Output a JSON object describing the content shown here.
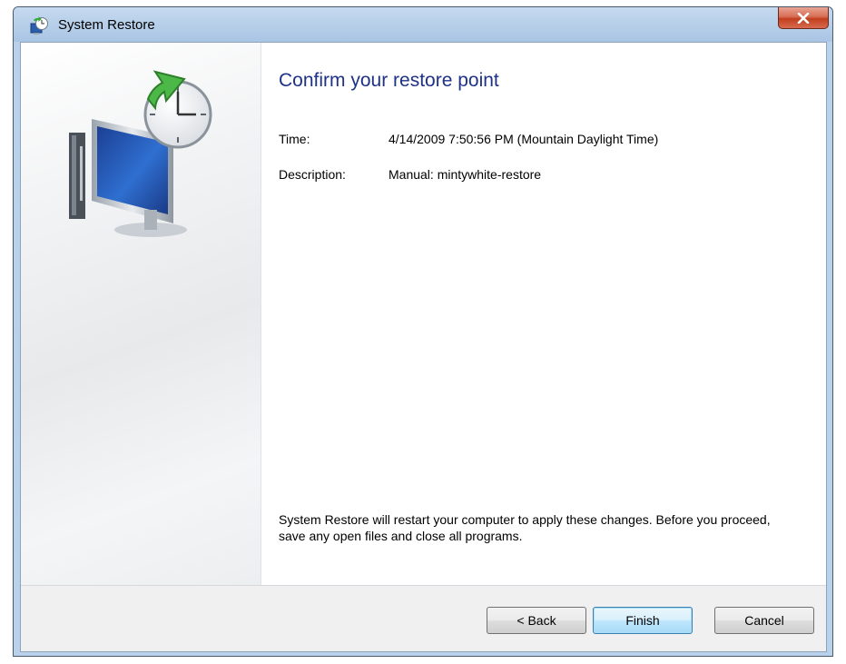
{
  "window": {
    "title": "System Restore"
  },
  "content": {
    "heading": "Confirm your restore point",
    "fields": [
      {
        "label": "Time:",
        "value": "4/14/2009 7:50:56 PM (Mountain Daylight Time)"
      },
      {
        "label": "Description:",
        "value": "Manual: mintywhite-restore"
      }
    ],
    "note": "System Restore will restart your computer to apply these changes. Before you proceed, save any open files and close all programs."
  },
  "buttons": {
    "back": "< Back",
    "finish": "Finish",
    "cancel": "Cancel"
  },
  "icons": {
    "app": "system-restore-icon",
    "close": "close-icon",
    "hero": "system-restore-hero-icon"
  },
  "colors": {
    "heading": "#1e3287",
    "titlebar": "#b9d1ea",
    "close_button": "#c23f1e",
    "default_button": "#bee6fd"
  }
}
